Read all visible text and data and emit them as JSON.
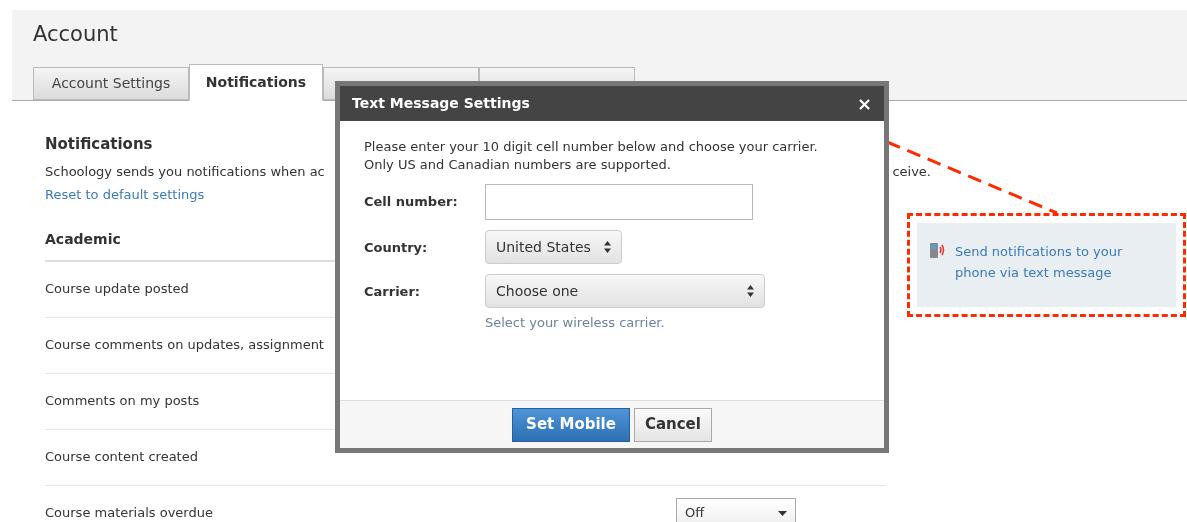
{
  "page": {
    "title": "Account"
  },
  "tabs": [
    {
      "label": "Account Settings",
      "selected": false
    },
    {
      "label": "Notifications",
      "selected": true
    },
    {
      "selected": false
    },
    {
      "selected": false
    }
  ],
  "section": {
    "title": "Notifications",
    "intro_start": "Schoology sends you notifications when ac",
    "intro_end": "ceive.",
    "reset_link": "Reset to default settings"
  },
  "group": {
    "title": "Academic",
    "rows": [
      {
        "label": "Course update posted"
      },
      {
        "label": "Course comments on updates, assignment"
      },
      {
        "label": "Comments on my posts"
      },
      {
        "label": "Course content created"
      },
      {
        "label": "Course materials overdue",
        "setting": "Off"
      }
    ]
  },
  "sidebar": {
    "link": "Send notifications to your phone via text message"
  },
  "dialog": {
    "title": "Text Message Settings",
    "close": "×",
    "intro": "Please enter your 10 digit cell number below and choose your carrier. Only US and Canadian numbers are supported.",
    "fields": [
      {
        "kind": "input",
        "label": "Cell number:"
      },
      {
        "kind": "select",
        "label": "Country:",
        "value": "United States"
      },
      {
        "kind": "select_wide",
        "label": "Carrier:",
        "value": "Choose one",
        "hint": "Select your wireless carrier."
      }
    ],
    "buttons": [
      {
        "label": "Set Mobile",
        "kind": "primary"
      },
      {
        "label": "Cancel",
        "kind": "secondary"
      }
    ]
  }
}
